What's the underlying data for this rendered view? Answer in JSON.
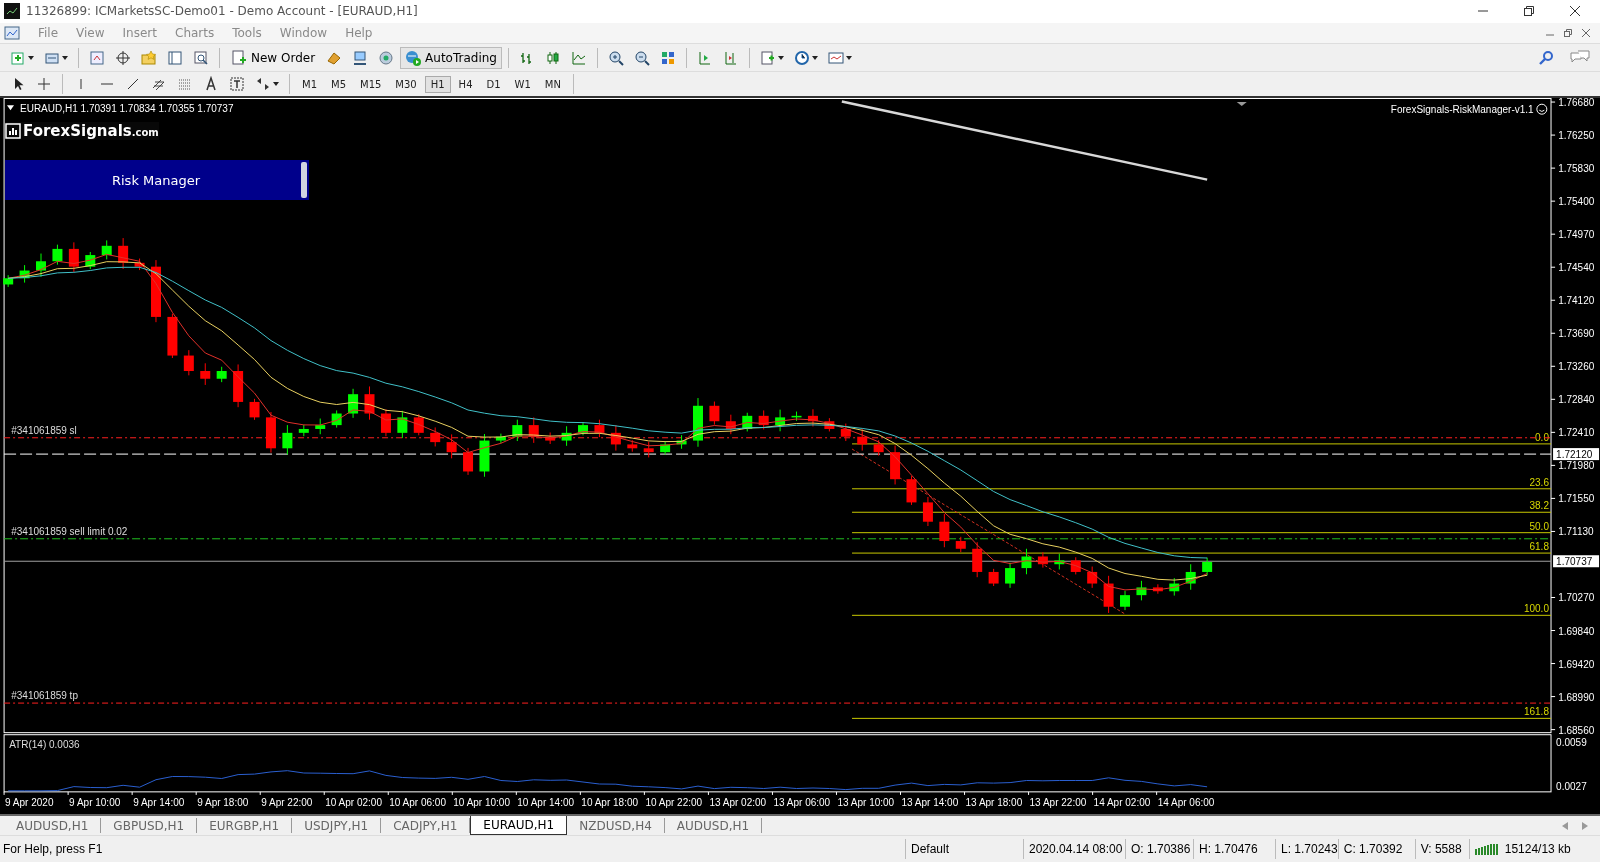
{
  "window": {
    "title": "11326899: ICMarketsSC-Demo01 - Demo Account - [EURAUD,H1]"
  },
  "menu": [
    "File",
    "View",
    "Insert",
    "Charts",
    "Tools",
    "Window",
    "Help"
  ],
  "toolbar": {
    "new_order": "New Order",
    "auto_trading": "AutoTrading"
  },
  "timeframes": [
    {
      "label": "M1",
      "selected": false
    },
    {
      "label": "M5",
      "selected": false
    },
    {
      "label": "M15",
      "selected": false
    },
    {
      "label": "M30",
      "selected": false
    },
    {
      "label": "H1",
      "selected": true
    },
    {
      "label": "H4",
      "selected": false
    },
    {
      "label": "D1",
      "selected": false
    },
    {
      "label": "W1",
      "selected": false
    },
    {
      "label": "MN",
      "selected": false
    }
  ],
  "chart": {
    "header": "EURAUD,H1  1.70391 1.70834 1.70355 1.70737",
    "logo_name": "ForexSignals",
    "logo_domain": ".com",
    "panel_button": "Risk Manager",
    "indicator_name": "ForexSignals-RiskManager-v1.1",
    "price_ticks": [
      "1.76680",
      "1.76250",
      "1.75830",
      "1.75400",
      "1.74970",
      "1.74540",
      "1.74120",
      "1.73690",
      "1.73260",
      "1.72840",
      "1.72410",
      "1.71980",
      "1.71550",
      "1.71130",
      "1.70270",
      "1.69840",
      "1.69420",
      "1.68990",
      "1.68560"
    ],
    "highlighted_prices": [
      "1.72120",
      "1.70737"
    ],
    "order_lines": [
      {
        "label": "#341061859 sl",
        "kind": "sl"
      },
      {
        "label": "#341061859 sell limit 0.02",
        "kind": "limit"
      },
      {
        "label": "#341061859 tp",
        "kind": "tp"
      }
    ],
    "fib_levels": [
      "0.0",
      "23.6",
      "38.2",
      "50.0",
      "61.8",
      "100.0",
      "161.8"
    ],
    "atr": {
      "label": "ATR(14) 0.0036",
      "ticks": [
        "0.0059",
        "0.0027"
      ]
    },
    "time_labels": [
      "9 Apr 2020",
      "9 Apr 10:00",
      "9 Apr 14:00",
      "9 Apr 18:00",
      "9 Apr 22:00",
      "10 Apr 02:00",
      "10 Apr 06:00",
      "10 Apr 10:00",
      "10 Apr 14:00",
      "10 Apr 18:00",
      "10 Apr 22:00",
      "13 Apr 02:00",
      "13 Apr 06:00",
      "13 Apr 10:00",
      "13 Apr 14:00",
      "13 Apr 18:00",
      "13 Apr 22:00",
      "14 Apr 02:00",
      "14 Apr 06:00"
    ]
  },
  "chart_tabs": [
    {
      "label": "AUDUSD,H1",
      "selected": false
    },
    {
      "label": "GBPUSD,H1",
      "selected": false
    },
    {
      "label": "EURGBP,H1",
      "selected": false
    },
    {
      "label": "USDJPY,H1",
      "selected": false
    },
    {
      "label": "CADJPY,H1",
      "selected": false
    },
    {
      "label": "EURAUD,H1",
      "selected": true
    },
    {
      "label": "NZDUSD,H4",
      "selected": false
    },
    {
      "label": "AUDUSD,H1",
      "selected": false
    }
  ],
  "status_bar": {
    "help": "For Help, press F1",
    "profile": "Default",
    "time": "2020.04.14 08:00",
    "open": "O: 1.70386",
    "high": "H: 1.70476",
    "low": "L: 1.70243",
    "close": "C: 1.70392",
    "volume": "V: 5588",
    "traffic": "15124/13 kb"
  }
}
